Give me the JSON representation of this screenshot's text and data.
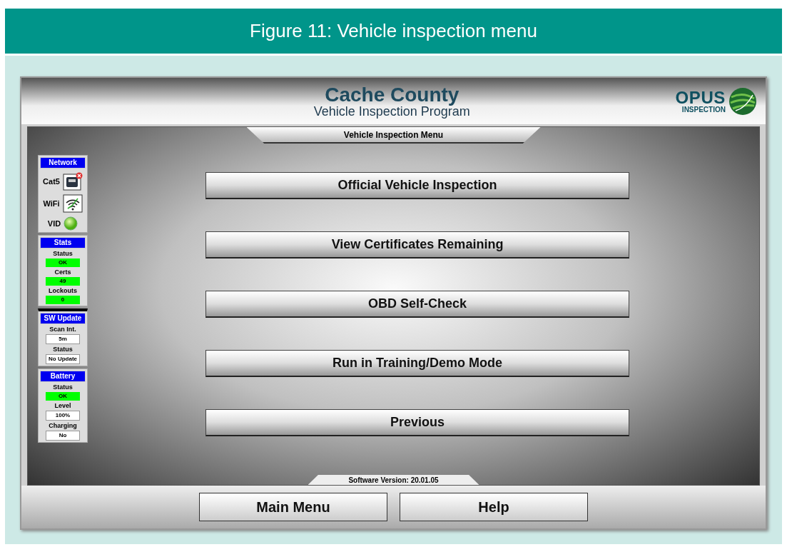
{
  "figure": {
    "caption": "Figure 11: Vehicle inspection menu"
  },
  "header": {
    "title": "Cache County",
    "subtitle": "Vehicle Inspection Program",
    "logo_word": "OPUS",
    "logo_sub": "INSPECTION"
  },
  "menu_title": "Vehicle Inspection Menu",
  "sidebar": {
    "network": {
      "title": "Network",
      "items": [
        {
          "kind": "ethernet",
          "label": "Cat5",
          "ok": false
        },
        {
          "kind": "wifi",
          "label": "WiFi",
          "ok": true
        },
        {
          "kind": "led",
          "label": "VID",
          "ok": true
        }
      ]
    },
    "groups": [
      {
        "title": "Stats",
        "fields": [
          {
            "label": "Status",
            "value": "OK",
            "kind": "status"
          },
          {
            "label": "Certs",
            "value": "49",
            "kind": "status"
          },
          {
            "label": "Lockouts",
            "value": "0",
            "kind": "status"
          }
        ]
      },
      {
        "title": "SW Update",
        "fields": [
          {
            "label": "Scan Int.",
            "value": "5m",
            "kind": "box"
          },
          {
            "label": "Status",
            "value": "No Update",
            "kind": "box"
          }
        ]
      },
      {
        "title": "Battery",
        "fields": [
          {
            "label": "Status",
            "value": "OK",
            "kind": "status"
          },
          {
            "label": "Level",
            "value": "100%",
            "kind": "box"
          },
          {
            "label": "Charging",
            "value": "No",
            "kind": "box"
          }
        ]
      }
    ]
  },
  "menu_buttons": [
    "Official Vehicle Inspection",
    "View Certificates Remaining",
    "OBD Self-Check",
    "Run in Training/Demo Mode",
    "Previous"
  ],
  "software_version": "Software Version: 20.01.05",
  "footer_buttons": [
    "Main Menu",
    "Help"
  ]
}
